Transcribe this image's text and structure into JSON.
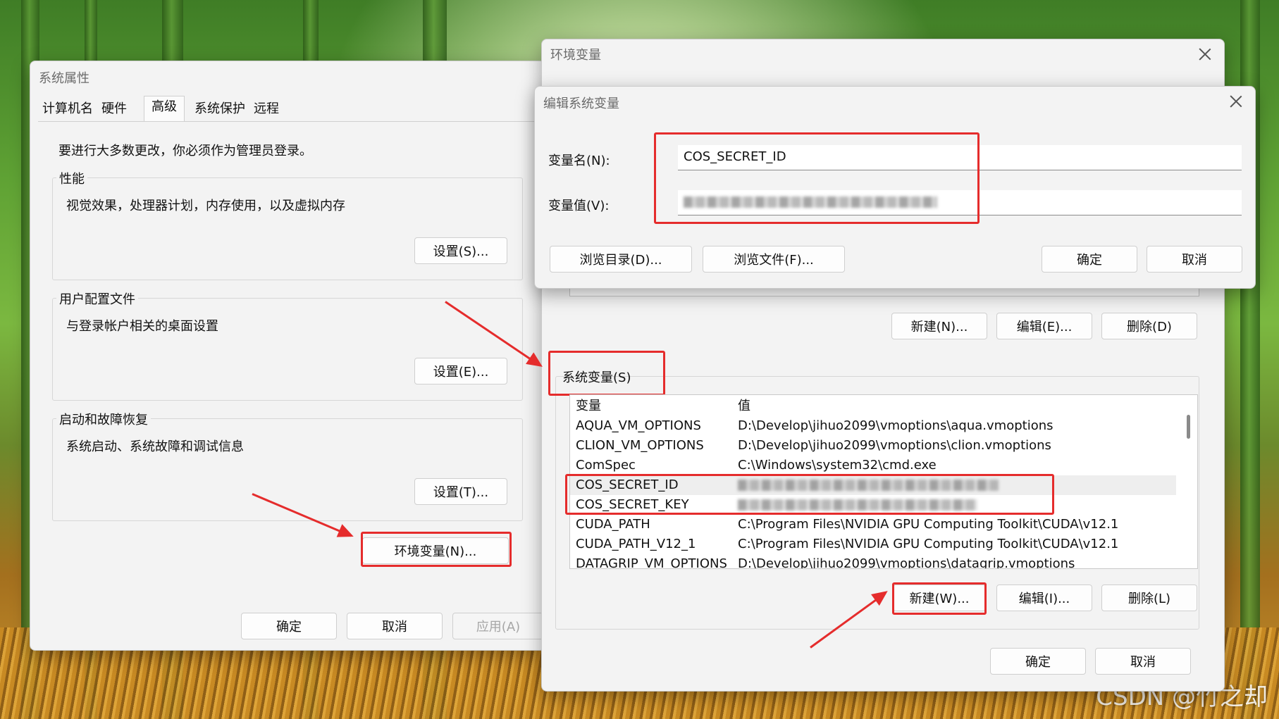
{
  "colors": {
    "highlight": "#e52c2c",
    "window_bg": "#f3f3f3"
  },
  "watermark": "CSDN @竹之却",
  "system_props": {
    "title": "系统属性",
    "tabs": [
      "计算机名",
      "硬件",
      "高级",
      "系统保护",
      "远程"
    ],
    "active_tab": "高级",
    "admin_notice": "要进行大多数更改，你必须作为管理员登录。",
    "performance": {
      "title": "性能",
      "desc": "视觉效果，处理器计划，内存使用，以及虚拟内存",
      "button": "设置(S)..."
    },
    "profile": {
      "title": "用户配置文件",
      "desc": "与登录帐户相关的桌面设置",
      "button": "设置(E)..."
    },
    "startup": {
      "title": "启动和故障恢复",
      "desc": "系统启动、系统故障和调试信息",
      "button": "设置(T)..."
    },
    "env_button": "环境变量(N)...",
    "ok": "确定",
    "cancel": "取消",
    "apply": "应用(A)"
  },
  "env_vars": {
    "title": "环境变量",
    "user_buttons": {
      "new": "新建(N)...",
      "edit": "编辑(E)...",
      "delete": "删除(D)"
    },
    "system_section": "系统变量(S)",
    "columns": [
      "变量",
      "值"
    ],
    "rows": [
      {
        "name": "AQUA_VM_OPTIONS",
        "value": "D:\\Develop\\jihuo2099\\vmoptions\\aqua.vmoptions"
      },
      {
        "name": "CLION_VM_OPTIONS",
        "value": "D:\\Develop\\jihuo2099\\vmoptions\\clion.vmoptions"
      },
      {
        "name": "ComSpec",
        "value": "C:\\Windows\\system32\\cmd.exe"
      },
      {
        "name": "COS_SECRET_ID",
        "value": ""
      },
      {
        "name": "COS_SECRET_KEY",
        "value": ""
      },
      {
        "name": "CUDA_PATH",
        "value": "C:\\Program Files\\NVIDIA GPU Computing Toolkit\\CUDA\\v12.1"
      },
      {
        "name": "CUDA_PATH_V12_1",
        "value": "C:\\Program Files\\NVIDIA GPU Computing Toolkit\\CUDA\\v12.1"
      },
      {
        "name": "DATAGRIP_VM_OPTIONS",
        "value": "D:\\Develop\\jihuo2099\\vmoptions\\datagrip.vmoptions"
      }
    ],
    "system_buttons": {
      "new": "新建(W)...",
      "edit": "编辑(I)...",
      "delete": "删除(L)"
    },
    "ok": "确定",
    "cancel": "取消"
  },
  "edit_var": {
    "title": "编辑系统变量",
    "name_label": "变量名(N):",
    "value_label": "变量值(V):",
    "name_value": "COS_SECRET_ID",
    "browse_dir": "浏览目录(D)...",
    "browse_file": "浏览文件(F)...",
    "ok": "确定",
    "cancel": "取消"
  }
}
